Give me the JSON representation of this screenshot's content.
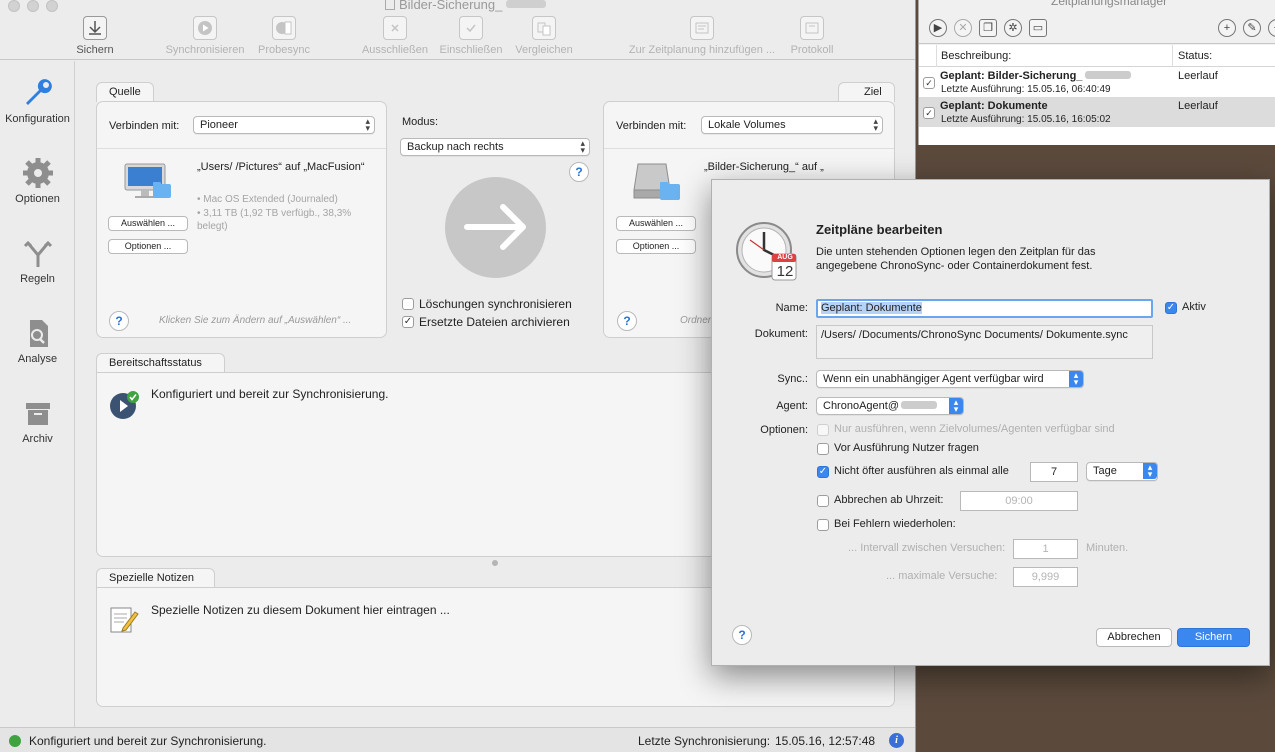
{
  "main_window": {
    "title": "Bilder-Sicherung_",
    "toolbar": [
      {
        "label": "Sichern",
        "icon": "download-icon",
        "enabled": true
      },
      {
        "label": "Synchronisieren",
        "icon": "play-icon",
        "enabled": false
      },
      {
        "label": "Probesync",
        "icon": "trial-sync-icon",
        "enabled": false
      },
      {
        "label": "Ausschließen",
        "icon": "exclude-icon",
        "enabled": false
      },
      {
        "label": "Einschließen",
        "icon": "include-icon",
        "enabled": false
      },
      {
        "label": "Vergleichen",
        "icon": "compare-icon",
        "enabled": false
      },
      {
        "label": "Zur Zeitplanung hinzufügen ...",
        "icon": "schedule-icon",
        "enabled": false
      },
      {
        "label": "Protokoll",
        "icon": "log-icon",
        "enabled": false
      }
    ],
    "sidebar": [
      {
        "label": "Konfiguration",
        "icon": "wrench-icon"
      },
      {
        "label": "Optionen",
        "icon": "gear-icon"
      },
      {
        "label": "Regeln",
        "icon": "fork-icon"
      },
      {
        "label": "Analyse",
        "icon": "analyze-icon"
      },
      {
        "label": "Archiv",
        "icon": "archive-box-icon"
      }
    ],
    "source": {
      "tab": "Quelle",
      "connect_label": "Verbinden mit:",
      "connect_value": "Pioneer",
      "path": "„Users/           /Pictures“ auf „MacFusion“",
      "detail1": "• Mac OS Extended (Journaled)",
      "detail2": "• 3,11 TB (1,92 TB verfügb., 38,3% belegt)",
      "select_btn": "Auswählen ...",
      "options_btn": "Optionen ...",
      "hint": "Klicken Sie zum Ändern auf „Auswählen“ ..."
    },
    "mode": {
      "label": "Modus:",
      "value": "Backup nach rechts",
      "sync_deletions": "Löschungen synchronisieren",
      "sync_deletions_checked": false,
      "archive_replaced": "Ersetzte Dateien archivieren",
      "archive_replaced_checked": true
    },
    "target": {
      "tab": "Ziel",
      "connect_label": "Verbinden mit:",
      "connect_value": "Lokale Volumes",
      "path": "„Bilder-Sicherung_“ auf „",
      "select_btn": "Auswählen ...",
      "options_btn": "Optionen ...",
      "hint": "Ordner"
    },
    "readiness": {
      "tab": "Bereitschaftsstatus",
      "text": "Konfiguriert und bereit zur Synchronisierung."
    },
    "notes": {
      "tab": "Spezielle Notizen",
      "placeholder": "Spezielle Notizen zu diesem Dokument hier eintragen ..."
    },
    "statusbar": {
      "left": "Konfiguriert und bereit zur Synchronisierung.",
      "last_sync_label": "Letzte Synchronisierung:",
      "last_sync_value": "15.05.16, 12:57:48"
    }
  },
  "scheduler": {
    "title": "Zeitplanungsmanager",
    "col_description": "Beschreibung:",
    "col_status": "Status:",
    "rows": [
      {
        "title": "Geplant: Bilder-Sicherung_",
        "subtitle": "Letzte Ausführung: 15.05.16, 06:40:49",
        "status": "Leerlauf",
        "checked": true
      },
      {
        "title": "Geplant: Dokumente",
        "subtitle": "Letzte Ausführung: 15.05.16, 16:05:02",
        "status": "Leerlauf",
        "checked": true
      }
    ]
  },
  "dialog": {
    "title": "Zeitpläne bearbeiten",
    "description": "Die unten stehenden Optionen legen den Zeitplan für das angegebene ChronoSync- oder Containerdokument fest.",
    "calendar_month": "AUG",
    "calendar_day": "12",
    "name_label": "Name:",
    "name_value": "Geplant: Dokumente",
    "active_label": "Aktiv",
    "active_checked": true,
    "document_label": "Dokument:",
    "document_value": "/Users/           /Documents/ChronoSync Documents/ Dokumente.sync",
    "sync_label": "Sync.:",
    "sync_value": "Wenn ein unabhängiger Agent verfügbar wird",
    "agent_label": "Agent:",
    "agent_value": "ChronoAgent@",
    "options_label": "Optionen:",
    "opt_only_when": "Nur ausführen, wenn Zielvolumes/Agenten verfügbar sind",
    "opt_ask_user": "Vor Ausführung Nutzer fragen",
    "opt_not_more_often": "Nicht öfter ausführen als einmal alle",
    "opt_not_more_often_value": "7",
    "opt_not_more_often_unit": "Tage",
    "opt_abort_at": "Abbrechen ab Uhrzeit:",
    "opt_abort_time": "09:00",
    "opt_retry": "Bei Fehlern wiederholen:",
    "retry_interval_label": "... Intervall zwischen Versuchen:",
    "retry_interval_value": "1",
    "retry_interval_unit": "Minuten.",
    "retry_max_label": "... maximale Versuche:",
    "retry_max_value": "9,999",
    "cancel_btn": "Abbrechen",
    "save_btn": "Sichern"
  }
}
